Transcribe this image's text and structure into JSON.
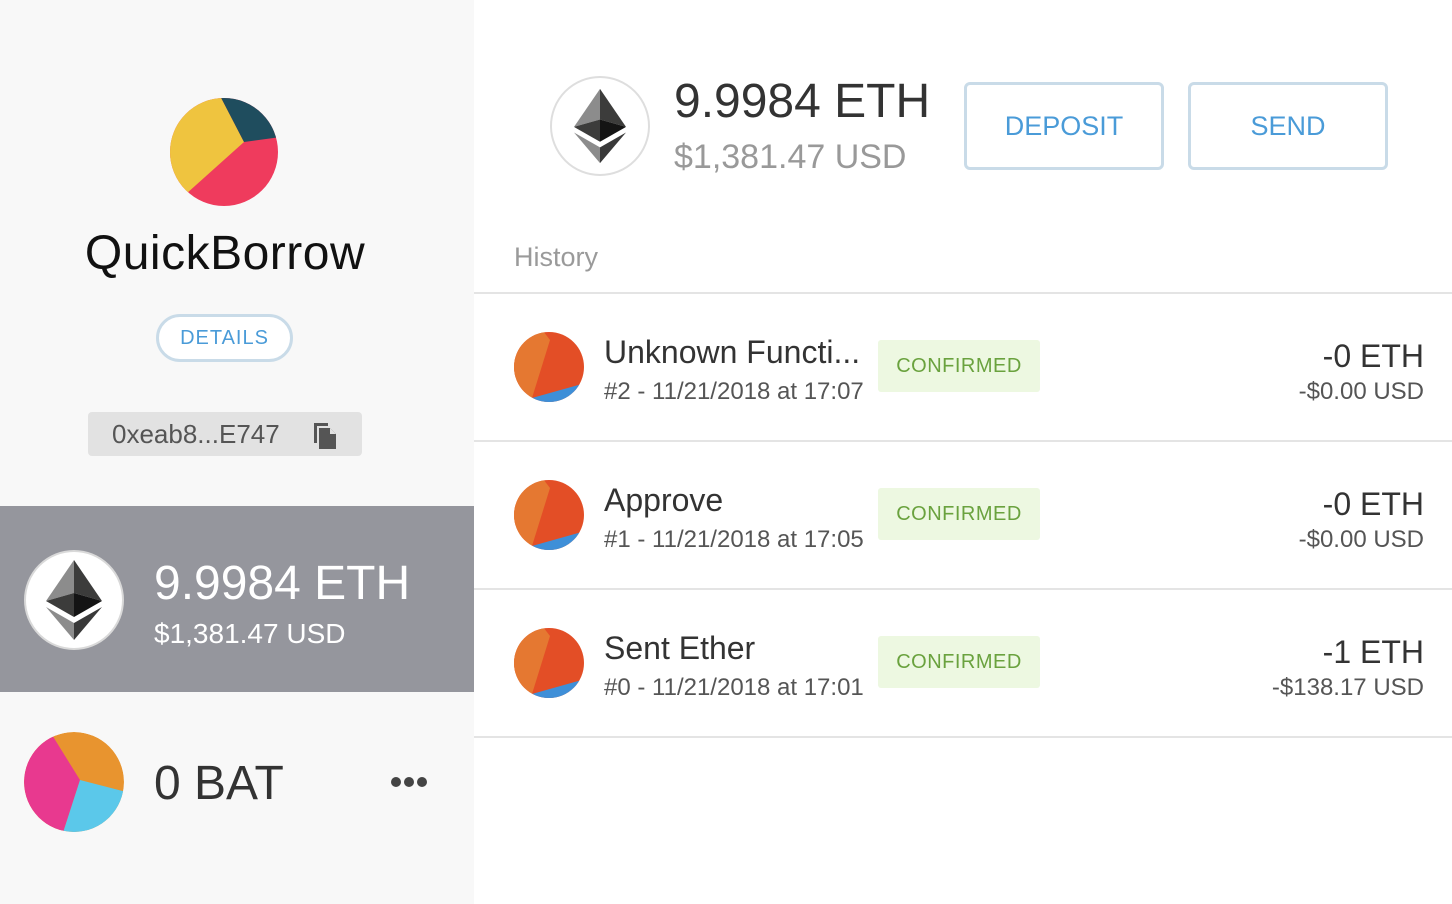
{
  "sidebar": {
    "account_name": "QuickBorrow",
    "details_label": "DETAILS",
    "address": "0xeab8...E747",
    "tokens": [
      {
        "amount": "9.9984 ETH",
        "usd": "$1,381.47 USD",
        "icon": "ethereum-icon",
        "selected": true
      },
      {
        "amount": "0 BAT",
        "usd": "",
        "icon": "bat-identicon",
        "selected": false
      }
    ]
  },
  "main": {
    "balance": "9.9984 ETH",
    "balance_usd": "$1,381.47 USD",
    "deposit_label": "DEPOSIT",
    "send_label": "SEND",
    "history_label": "History",
    "transactions": [
      {
        "title": "Unknown Functi...",
        "meta": "#2 - 11/21/2018 at 17:07",
        "status": "CONFIRMED",
        "amount": "-0 ETH",
        "usd": "-$0.00 USD"
      },
      {
        "title": "Approve",
        "meta": "#1 - 11/21/2018 at 17:05",
        "status": "CONFIRMED",
        "amount": "-0 ETH",
        "usd": "-$0.00 USD"
      },
      {
        "title": "Sent Ether",
        "meta": "#0 - 11/21/2018 at 17:01",
        "status": "CONFIRMED",
        "amount": "-1 ETH",
        "usd": "-$138.17 USD"
      }
    ]
  },
  "colors": {
    "accent": "#4a9bd8",
    "sidebar_selected": "#95969d",
    "confirmed_bg": "#edf8e1",
    "confirmed_text": "#6aa23e"
  }
}
